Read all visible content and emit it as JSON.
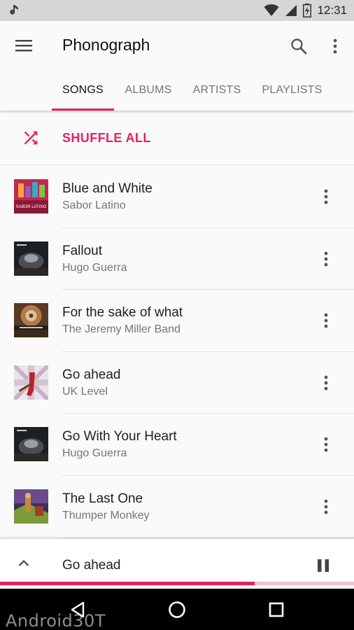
{
  "status_bar": {
    "time": "12:31"
  },
  "app": {
    "title": "Phonograph"
  },
  "tabs": [
    {
      "label": "SONGS",
      "active": true
    },
    {
      "label": "ALBUMS",
      "active": false
    },
    {
      "label": "ARTISTS",
      "active": false
    },
    {
      "label": "PLAYLISTS",
      "active": false
    }
  ],
  "shuffle": {
    "label": "SHUFFLE ALL"
  },
  "songs": [
    {
      "title": "Blue and White",
      "artist": "Sabor Latino",
      "art_text": "SABOR LATINO"
    },
    {
      "title": "Fallout",
      "artist": "Hugo Guerra"
    },
    {
      "title": "For the sake of what",
      "artist": "The Jeremy Miller Band"
    },
    {
      "title": "Go ahead",
      "artist": "UK Level"
    },
    {
      "title": "Go With Your Heart",
      "artist": "Hugo Guerra"
    },
    {
      "title": "The Last One",
      "artist": "Thumper Monkey"
    }
  ],
  "mini_player": {
    "title": "Go ahead",
    "progress": 0.72
  },
  "watermark": "Android30T",
  "colors": {
    "accent": "#e91e63",
    "status_bar": "#d6d6d6",
    "nav_bar": "#000000"
  },
  "icons": [
    "notification-icon",
    "wifi-icon",
    "signal-icon",
    "battery-icon",
    "menu-icon",
    "search-icon",
    "more-vert-icon",
    "shuffle-icon",
    "chevron-up-icon",
    "pause-icon",
    "back-icon",
    "home-icon",
    "recents-icon"
  ]
}
